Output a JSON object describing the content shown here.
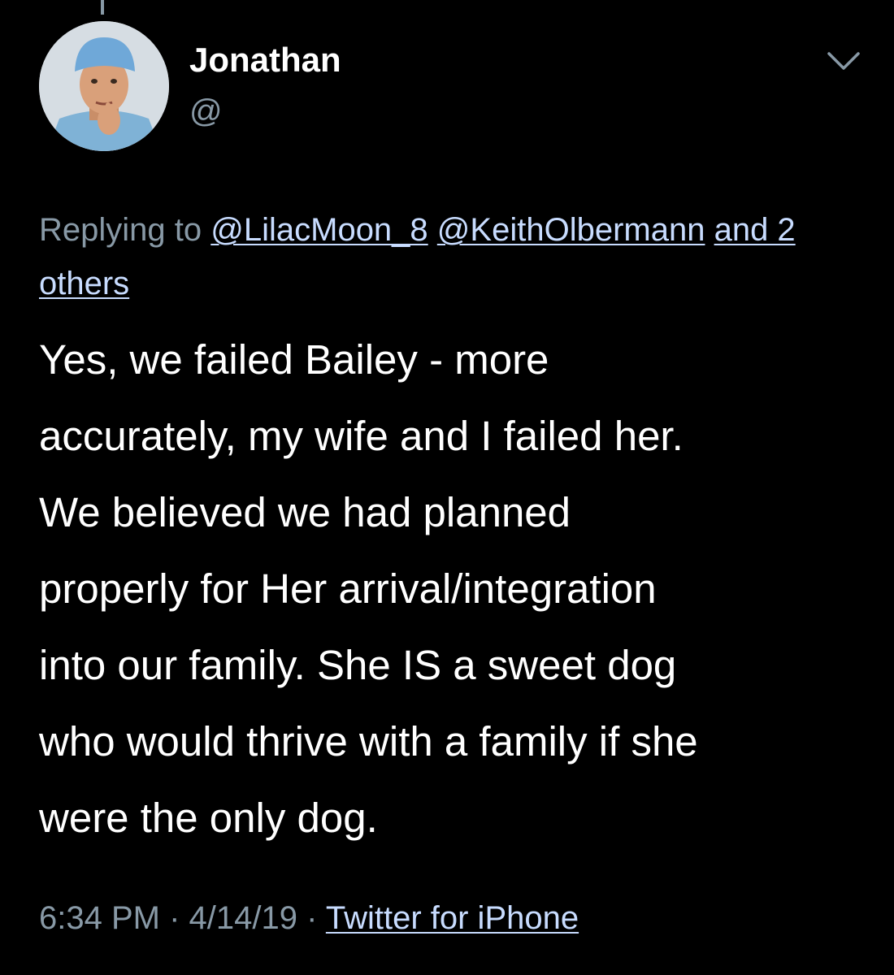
{
  "author": {
    "name": "Jonathan",
    "handle": "@"
  },
  "reply": {
    "prefix": "Replying to",
    "mention_1": "@LilacMoon_8",
    "mention_2": "@KeithOlbermann",
    "others": "and 2 others"
  },
  "tweet": {
    "lines": [
      "Yes, we failed Bailey - more",
      "accurately, my wife and I failed her.",
      "We believed we had planned",
      "properly for Her arrival/integration",
      "into our family. She IS a sweet dog",
      "who would thrive with a family if she",
      "were the only dog."
    ]
  },
  "meta": {
    "time": "6:34 PM",
    "separator": "·",
    "date": "4/14/19",
    "source": "Twitter for iPhone"
  },
  "colors": {
    "background": "#000000",
    "text": "#ffffff",
    "secondary": "#8899a6",
    "link": "#c8dcff"
  },
  "icons": {
    "menu": "chevron-down-icon",
    "avatar": "profile-photo"
  }
}
